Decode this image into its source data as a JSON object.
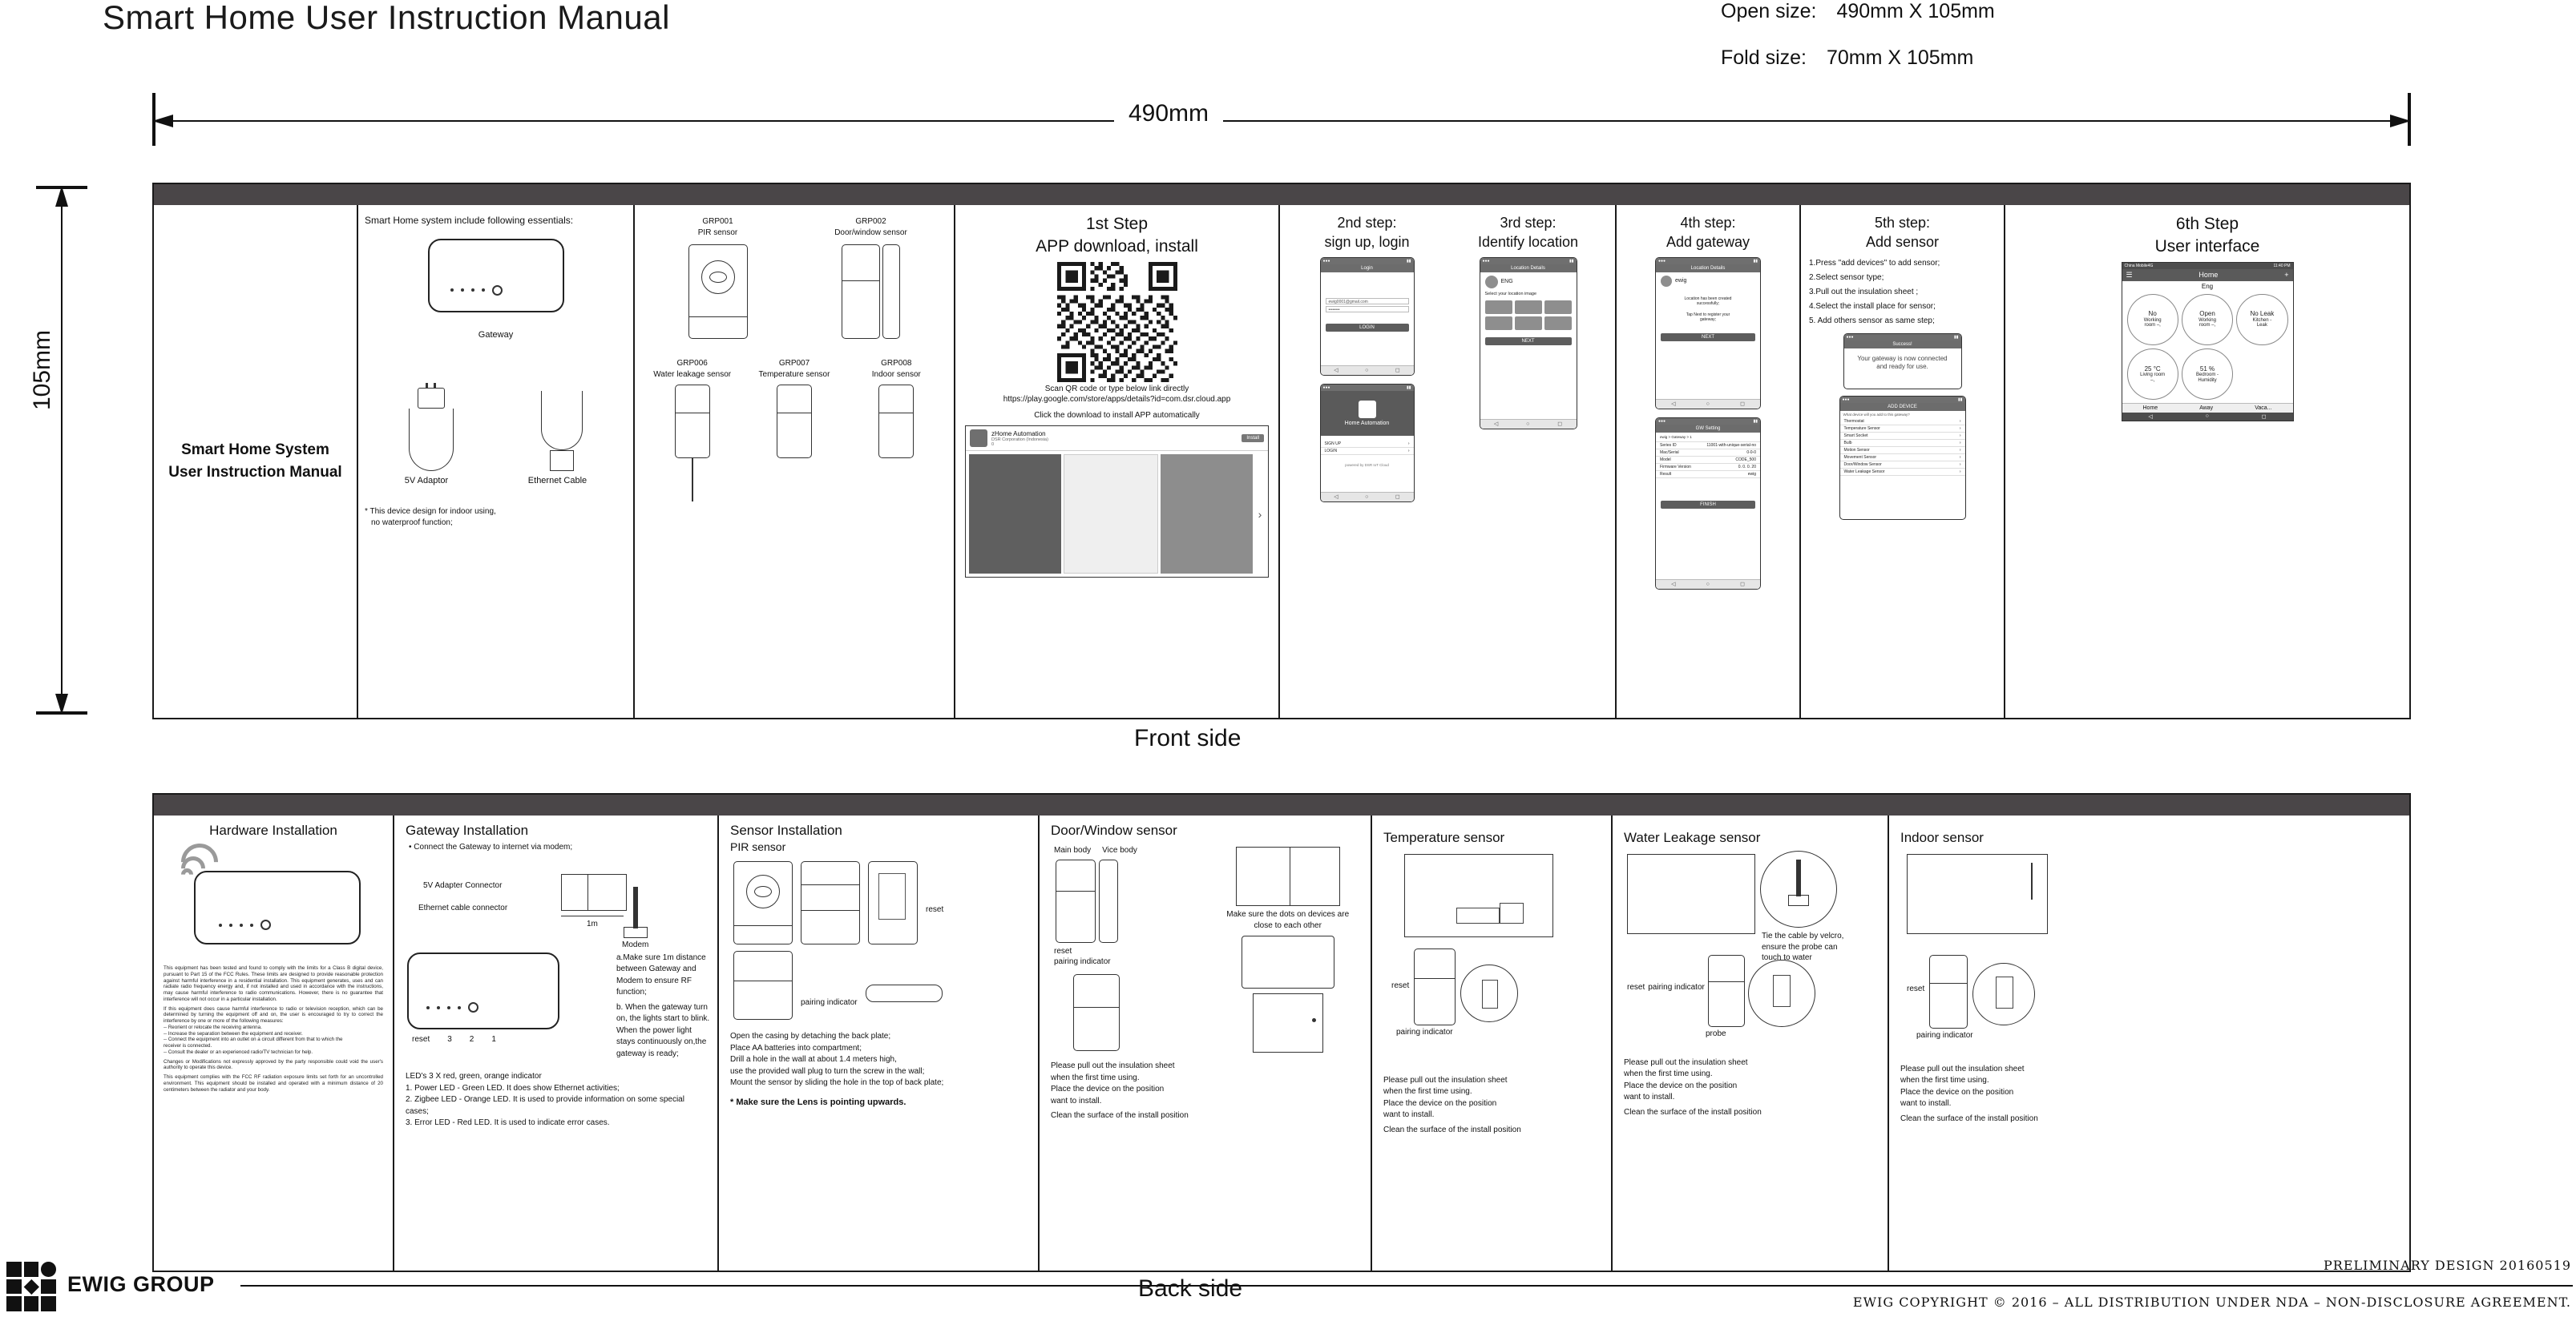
{
  "header": {
    "title": "Smart Home User Instruction Manual",
    "open_size_label": "Open size:",
    "open_size_value": "490mm X 105mm",
    "fold_size_label": "Fold size:",
    "fold_size_value": "70mm X 105mm"
  },
  "dimensions": {
    "width_label": "490mm",
    "height_label": "105mm"
  },
  "front": {
    "side_label": "Front side",
    "cover": {
      "title_line1": "Smart Home System",
      "title_line2": "User Instruction Manual"
    },
    "essentials": {
      "heading": "Smart Home system include following essentials:",
      "gateway_label": "Gateway",
      "adaptor_label": "5V Adaptor",
      "ethernet_label": "Ethernet Cable",
      "footnote_line1": "* This device design for indoor using,",
      "footnote_line2": "no waterproof function;"
    },
    "sensors": [
      {
        "code": "GRP001",
        "name": "PIR sensor"
      },
      {
        "code": "GRP002",
        "name": "Door/window sensor"
      },
      {
        "code": "GRP006",
        "name": "Water leakage sensor"
      },
      {
        "code": "GRP007",
        "name": "Temperature sensor"
      },
      {
        "code": "GRP008",
        "name": "Indoor sensor"
      }
    ],
    "step1": {
      "head_line1": "1st Step",
      "head_line2": "APP download, install",
      "scan_text": "Scan QR code or type below link directly",
      "url": "https://play.google.com/store/apps/details?id=com.dsr.cloud.app",
      "click_text": "Click the download to install APP automatically",
      "store_app_name": "zHome Automation",
      "store_app_sub": "DSR Corporation (Indonesia)",
      "store_install_btn": "Install",
      "store_rating": "0"
    },
    "step2": {
      "head_line1": "2nd step:",
      "head_line2": "sign up, login",
      "screen_title": "Login",
      "email_value": "ewig0001@gmail.com",
      "password_value": "••••••••",
      "login_btn": "LOGIN",
      "signup_btn": "SIGN UP",
      "login_link": "LOGIN",
      "app_name": "Home Automation",
      "powered_by": "powered by DSR IoT Cloud"
    },
    "step3": {
      "head_line1": "3rd step:",
      "head_line2": "Identify location",
      "screen_title": "Location Details",
      "lang_value": "ENG",
      "pick_text": "Select your location image",
      "next_btn": "NEXT"
    },
    "step4": {
      "head_line1": "4th step:",
      "head_line2": "Add gateway",
      "screen_title": "Location Details",
      "name_value": "ewig",
      "created_text_line1": "Location has been created",
      "created_text_line2": "successfully;",
      "tap_text_line1": "Tap Next to register your",
      "tap_text_line2": "gateway;",
      "next_btn": "NEXT",
      "gw_setting_title": "GW Setting",
      "fields": [
        {
          "label": "Series ID",
          "value": "11001-with-unique-serial-no"
        },
        {
          "label": "Mac/Serial",
          "value": "0-0-0"
        },
        {
          "label": "Model",
          "value": "CODE_500"
        },
        {
          "label": "Firmware Version",
          "value": "0. 0. 0. 20"
        },
        {
          "label": "Result",
          "value": "ewig"
        }
      ],
      "finish_btn": "FINISH",
      "breadcrumb": "ewig  >  Gateway  >  1"
    },
    "step5": {
      "head_line1": "5th step:",
      "head_line2": "Add sensor",
      "instructions": [
        "1.Press \"add devices\" to add sensor;",
        "2.Select sensor type;",
        "3.Pull out the insulation sheet ;",
        "4.Select the install place for sensor;",
        "5. Add others sensor as same step;"
      ],
      "success_title": "Success!",
      "success_text_line1": "Your gateway is now connected",
      "success_text_line2": "and ready for use.",
      "add_device_title": "ADD DEVICE",
      "device_list_heading": "What device will you add to this gateway?",
      "device_list": [
        "Thermostat",
        "Temperature Sensor",
        "Smart Socket",
        "Bulb",
        "Motion Sensor",
        "Movement Sensor",
        "Door/Window Sensor",
        "Water Leakage Sensor"
      ]
    },
    "step6": {
      "head_line1": "6th Step",
      "head_line2": "User interface",
      "status_carrier": "China Mobile4G",
      "status_time": "11:40 PM",
      "app_title": "Home",
      "add_icon": "plus-icon",
      "lang_value": "Eng",
      "tiles": [
        {
          "big": "No",
          "sub_line1": "Working",
          "sub_line2": "room –,"
        },
        {
          "big": "Open",
          "sub_line1": "Working",
          "sub_line2": "room –,"
        },
        {
          "big": "No Leak",
          "sub_line1": "Kitchen -",
          "sub_line2": "Leak"
        },
        {
          "big": "25 °C",
          "sub_line1": "Living room",
          "sub_line2": "–,"
        },
        {
          "big": "51 %",
          "sub_line1": "Bedroom -",
          "sub_line2": "Humidity"
        }
      ],
      "footer_tabs": [
        "Home",
        "Away",
        "Vaca..."
      ]
    }
  },
  "back": {
    "side_label": "Back side",
    "hardware": {
      "heading": "Hardware Installation",
      "legal": "This equipment has been tested and found to comply with the limits for a Class B digital device, pursuant to Part 15 of the FCC Rules. These limits are designed to provide reasonable protection against harmful interference in a residential installation. This equipment generates, uses and can radiate radio frequency energy and, if not installed and used in accordance with the instructions, may cause harmful interference to radio communications. However, there is no guarantee that interference will not occur in a particular installation.",
      "legal2": "If this equipment does cause harmful interference to radio or television reception, which can be determined by turning the equipment off and on, the user is encouraged to try to correct the interference by one or more of the following measures:",
      "legal_bullets": [
        "-- Reorient or relocate the receiving antenna.",
        "-- Increase the separation between the equipment and receiver.",
        "-- Connect the equipment into an outlet on a circuit different from that to which the",
        "    receiver is connected.",
        "-- Consult the dealer or an experienced radio/TV technician for help."
      ],
      "legal3": "Changes or Modifications not expressly approved by the party responsible could void the user's authority to operate this device.",
      "legal4": "This equipment complies with the FCC RF radiation exposure limits set forth for an uncontrolled environment. This equipment should be installed and operated with a minimum distance of 20 centimeters between the radiator and your body."
    },
    "gateway": {
      "heading": "Gateway Installation",
      "bullet": "Connect the Gateway to internet via modem;",
      "adapter_label": "5V Adapter Connector",
      "ethernet_label": "Ethernet cable connector",
      "distance_label": "1m",
      "modem_label": "Modem",
      "note_a": "a.Make sure 1m distance between Gateway and Modem to ensure RF function;",
      "note_b": "b. When the gateway turn on, the lights start to blink. When the power light stays continuously on,the gateway is ready;",
      "reset_labels": [
        "reset",
        "3",
        "2",
        "1"
      ],
      "led_heading": "LED's 3 X red, green, orange indicator",
      "led_items": [
        "1. Power LED - Green LED. It does show Ethernet activities;",
        "2. Zigbee LED - Orange LED. It is used to provide information on some special cases;",
        "3. Error LED - Red LED. It is used to indicate error cases."
      ]
    },
    "pir": {
      "heading": "Sensor Installation",
      "subheading": "PIR sensor",
      "pairing_label": "pairing indicator",
      "reset_label": "reset",
      "steps": [
        "Open the casing by detaching the back plate;",
        "Place AA batteries into compartment;",
        "Drill a hole in the wall at about 1.4 meters high,",
        "use the provided wall plug to turn the screw in the wall;",
        "Mount the sensor by sliding the hole in the top of back plate;"
      ],
      "bold_note": "* Make sure the Lens is pointing upwards."
    },
    "door": {
      "heading": "Door/Window sensor",
      "main_body_label": "Main body",
      "vice_body_label": "Vice body",
      "reset_label": "reset",
      "pairing_label": "pairing indicator",
      "dots_note_line1": "Make sure the dots on devices are",
      "dots_note_line2": "close to each other",
      "steps": [
        "Please pull out the insulation sheet",
        "when the first time using.",
        "Place the device on the position",
        "want to install.",
        "Clean the surface of the install position"
      ]
    },
    "temperature": {
      "heading": "Temperature sensor",
      "reset_label": "reset",
      "pairing_label": "pairing indicator",
      "steps": [
        "Please pull out the insulation sheet",
        "when the first time using.",
        "Place the device on the position",
        "want to install.",
        "Clean the surface of the install position"
      ]
    },
    "water": {
      "heading": "Water Leakage sensor",
      "reset_label": "reset",
      "pairing_label": "pairing indicator",
      "probe_label": "probe",
      "tie_note_line1": "Tie the cable by velcro,",
      "tie_note_line2": "ensure the probe can",
      "tie_note_line3": "touch to water",
      "steps": [
        "Please pull out the insulation sheet",
        "when the first time using.",
        "Place the device on the position",
        "want to install.",
        "Clean the surface of the install position"
      ]
    },
    "indoor": {
      "heading": "Indoor sensor",
      "reset_label": "reset",
      "pairing_label": "pairing indicator",
      "steps": [
        "Please pull out the insulation sheet",
        "when the first time using.",
        "Place the device on the position",
        "want to install.",
        "Clean the surface of the install position"
      ]
    }
  },
  "footer": {
    "brand": "EWIG GROUP",
    "prelim": "PRELIMINARY  DESIGN  20160519",
    "copyright": "EWIG COPYRIGHT © 2016 – ALL DISTRIBUTION UNDER NDA – NON-DISCLOSURE AGREEMENT."
  }
}
